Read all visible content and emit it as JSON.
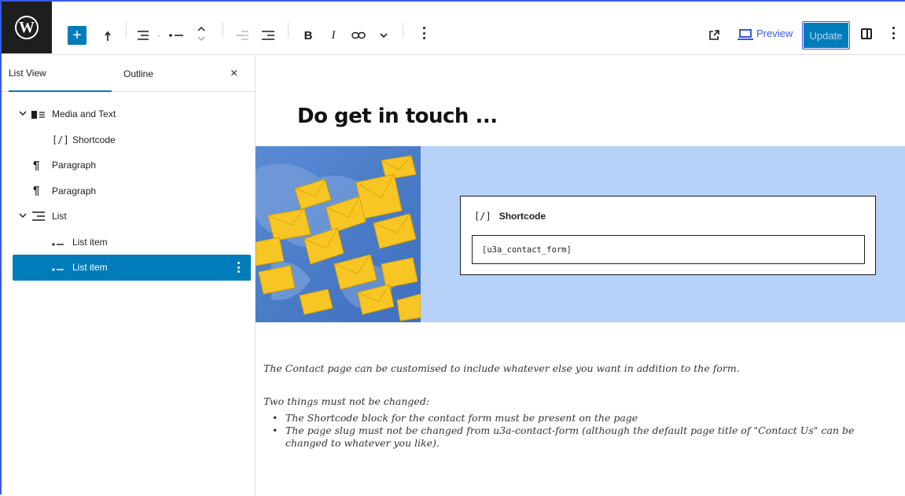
{
  "toolbar": {
    "logo_letter": "W",
    "add_label": "+",
    "preview_label": "Preview",
    "update_label": "Update",
    "accent_color": "#007cba",
    "icons": [
      "wordpress-logo",
      "add-block-icon",
      "undo-arrow-icon",
      "list-style-icon",
      "list-bullet-icon",
      "move-up-down-icon",
      "outdent-icon",
      "indent-icon",
      "bold-icon",
      "italic-icon",
      "link-icon",
      "chevron-down-icon",
      "more-options-icon",
      "external-link-icon",
      "preview-monitor-icon",
      "sidebar-toggle-icon"
    ]
  },
  "panel": {
    "tabs": [
      "List View",
      "Outline"
    ],
    "close_glyph": "×",
    "items": [
      {
        "label": "Media and Text",
        "icon": "media-text-icon"
      },
      {
        "label": "Shortcode",
        "icon": "shortcode-icon",
        "glyph": "[/]"
      },
      {
        "label": "Paragraph",
        "icon": "paragraph-icon",
        "glyph": "¶"
      },
      {
        "label": "Paragraph",
        "icon": "paragraph-icon",
        "glyph": "¶"
      },
      {
        "label": "List",
        "icon": "list-icon"
      },
      {
        "label": "List item",
        "icon": "list-item-icon"
      },
      {
        "label": "List item",
        "icon": "list-item-icon"
      }
    ]
  },
  "canvas": {
    "heading": "Do get in touch ...",
    "shortcode": {
      "glyph": "[/]",
      "title": "Shortcode",
      "value": "[u3a_contact_form]"
    },
    "media_bg": "#b6d2f8",
    "para1": "The Contact page can be customised to include whatever else you want in addition to the form.",
    "para2": "Two things must not be changed:",
    "list": [
      "The Shortcode block for the contact form must be present on the page",
      "The page slug must not be changed from u3a-contact-form (although the default page title of \"Contact Us\" can be changed to whatever you like)."
    ]
  }
}
